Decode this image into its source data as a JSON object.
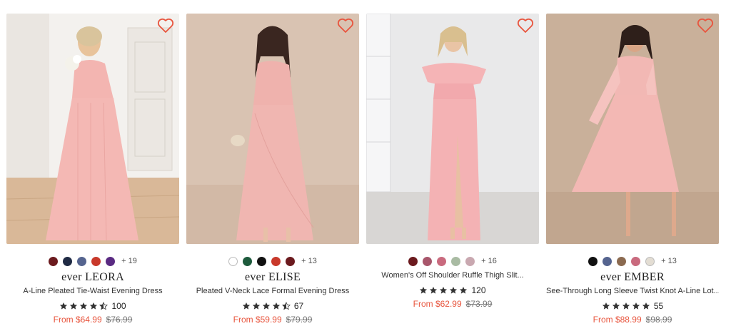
{
  "colors": {
    "accent": "#e8553e",
    "star": "#333333",
    "heart": "#e8553e"
  },
  "products": [
    {
      "brand": "ever LEORA",
      "name": "A-Line Pleated Tie-Waist Evening Dress",
      "swatches": [
        "#6b1a1e",
        "#1f2a44",
        "#55648f",
        "#c8392b",
        "#5a2a82"
      ],
      "more_colors": "+ 19",
      "rating": 4.5,
      "reviews": "100",
      "price_now": "From $64.99",
      "price_was": "$76.99",
      "wishlist_icon": "heart-outline-icon"
    },
    {
      "brand": "ever ELISE",
      "name": "Pleated V-Neck Lace Formal Evening Dress",
      "swatches": [
        "#ffffff",
        "#1d5a3c",
        "#111111",
        "#c8392b",
        "#6b1a1e"
      ],
      "more_colors": "+ 13",
      "rating": 4.5,
      "reviews": "67",
      "price_now": "From $59.99",
      "price_was": "$79.99",
      "wishlist_icon": "heart-outline-icon"
    },
    {
      "brand": "",
      "name": "Women's Off Shoulder Ruffle Thigh Slit...",
      "swatches": [
        "#6b1a1e",
        "#a8566b",
        "#c96a7e",
        "#a9bba3",
        "#c9a8b0"
      ],
      "more_colors": "+ 16",
      "rating": 5,
      "reviews": "120",
      "price_now": "From $62.99",
      "price_was": "$73.99",
      "wishlist_icon": "heart-outline-icon"
    },
    {
      "brand": "ever EMBER",
      "name": "See-Through Long Sleeve Twist Knot A-Line Lot...",
      "swatches": [
        "#111111",
        "#55648f",
        "#8b6a50",
        "#c96a7e",
        "#e3ddd3"
      ],
      "more_colors": "+ 13",
      "rating": 5,
      "reviews": "55",
      "price_now": "From $88.99",
      "price_was": "$98.99",
      "wishlist_icon": "heart-outline-icon"
    }
  ]
}
